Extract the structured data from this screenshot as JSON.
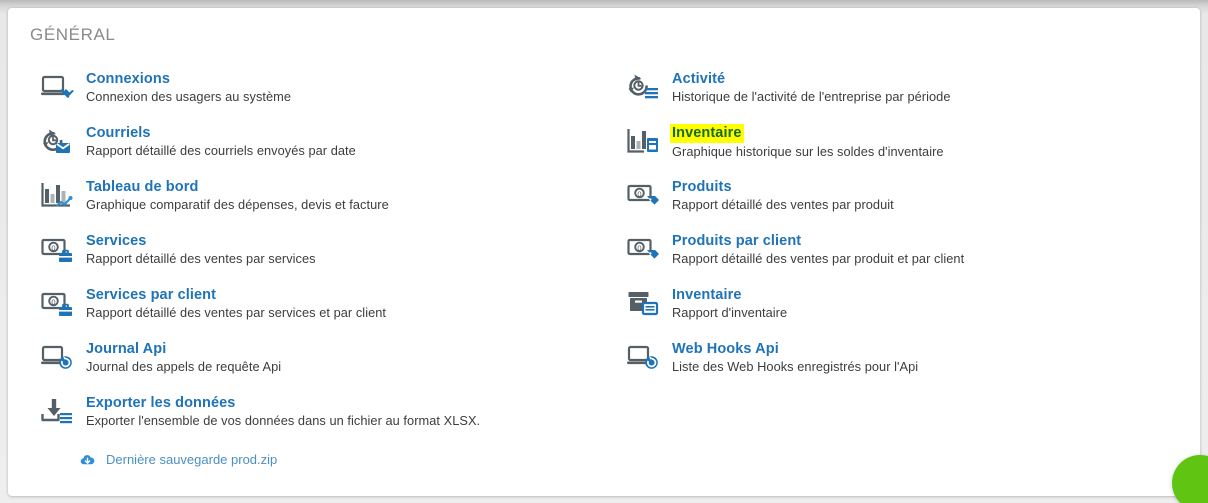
{
  "section": {
    "title": "GÉNÉRAL"
  },
  "colors": {
    "link": "#1f73b7",
    "icon_dark": "#555f66",
    "icon_accent": "#1f73b7",
    "highlight_background": "#ffff00",
    "highlight_text": "#176b1d",
    "page_background": "#eeeeee",
    "card_background": "#ffffff",
    "chat_bubble": "#5fc512"
  },
  "columns": {
    "left": [
      {
        "icon": "laptop-plug-icon",
        "title": "Connexions",
        "description": "Connexion des usagers au système",
        "highlighted": false
      },
      {
        "icon": "history-mail-icon",
        "title": "Courriels",
        "description": "Rapport détaillé des courriels envoyés par date",
        "highlighted": false
      },
      {
        "icon": "bar-chart-trend-icon",
        "title": "Tableau de bord",
        "description": "Graphique comparatif des dépenses, devis et facture",
        "highlighted": false
      },
      {
        "icon": "banknote-briefcase-icon",
        "title": "Services",
        "description": "Rapport détaillé des ventes par services",
        "highlighted": false
      },
      {
        "icon": "banknote-briefcase-icon",
        "title": "Services par client",
        "description": "Rapport détaillé des ventes par services et par client",
        "highlighted": false
      },
      {
        "icon": "laptop-history-icon",
        "title": "Journal Api",
        "description": "Journal des appels de requête Api",
        "highlighted": false
      },
      {
        "icon": "export-download-icon",
        "title": "Exporter les données",
        "description": "Exporter l'ensemble de vos données dans un fichier au format XLSX.",
        "highlighted": false
      }
    ],
    "right": [
      {
        "icon": "history-list-icon",
        "title": "Activité",
        "description": "Historique de l'activité de l'entreprise par période",
        "highlighted": false
      },
      {
        "icon": "bar-chart-box-icon",
        "title": "Inventaire",
        "description": "Graphique historique sur les soldes d'inventaire",
        "highlighted": true
      },
      {
        "icon": "banknote-tag-icon",
        "title": "Produits",
        "description": "Rapport détaillé des ventes par produit",
        "highlighted": false
      },
      {
        "icon": "banknote-tag-icon",
        "title": "Produits par client",
        "description": "Rapport détaillé des ventes par produit et par client",
        "highlighted": false
      },
      {
        "icon": "archive-box-card-icon",
        "title": "Inventaire",
        "description": "Rapport d'inventaire",
        "highlighted": false
      },
      {
        "icon": "laptop-refresh-icon",
        "title": "Web Hooks Api",
        "description": "Liste des Web Hooks enregistrés pour l'Api",
        "highlighted": false
      }
    ]
  },
  "backup": {
    "icon": "cloud-download-icon",
    "label": "Dernière sauvegarde prod.zip"
  },
  "chat_widget": {
    "icon": "chat-bubble-icon"
  }
}
